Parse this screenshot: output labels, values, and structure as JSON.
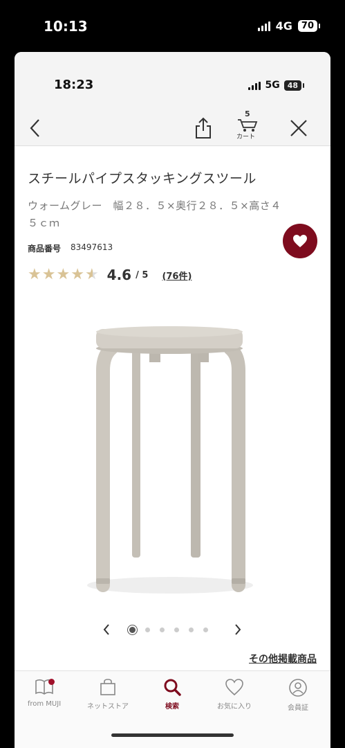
{
  "outer_status": {
    "time": "10:13",
    "network": "4G",
    "battery": "70"
  },
  "inner_status": {
    "time": "18:23",
    "network": "5G",
    "battery": "48"
  },
  "header": {
    "cart_count": "5",
    "cart_label": "カート"
  },
  "product": {
    "title": "スチールパイプスタッキングスツール",
    "subtitle": "ウォームグレー　幅２８．５×奥行２８．５×高さ４５ｃｍ",
    "code_label": "商品番号",
    "code_value": "83497613",
    "rating_score": "4.6",
    "rating_outof": "/ 5",
    "rating_value": 4.6,
    "review_count": "(76件)"
  },
  "gallery": {
    "total": 6,
    "active_index": 0
  },
  "other_link": "その他掲載商品",
  "tabbar": {
    "items": [
      {
        "label": "from MUJI",
        "icon": "book-icon"
      },
      {
        "label": "ネットストア",
        "icon": "bag-icon"
      },
      {
        "label": "検索",
        "icon": "search-icon"
      },
      {
        "label": "お気に入り",
        "icon": "heart-icon"
      },
      {
        "label": "会員証",
        "icon": "member-icon"
      }
    ],
    "active": 2
  },
  "colors": {
    "accent": "#7e0c1e",
    "star": "#d9c396",
    "product_grey": "#cdc8bf"
  }
}
